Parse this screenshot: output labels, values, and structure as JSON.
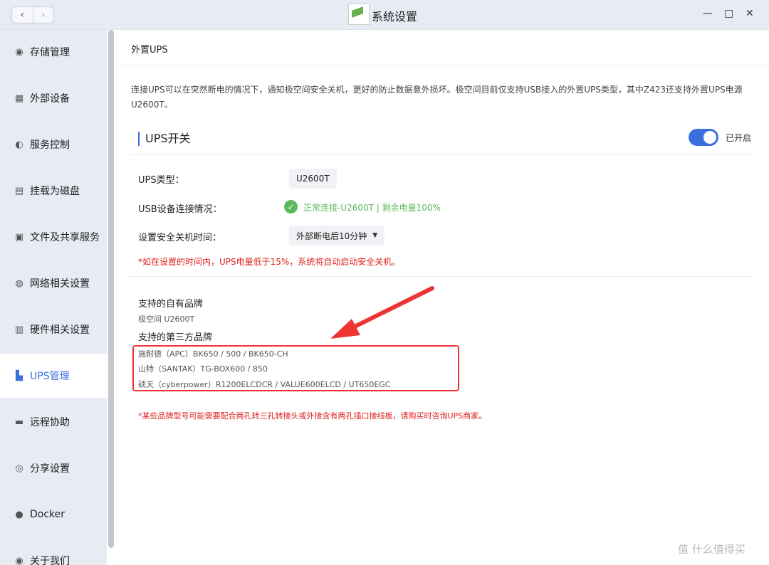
{
  "window": {
    "title": "系统设置",
    "back_icon": "‹",
    "forward_icon": "›",
    "min_icon": "—",
    "max_icon": "□",
    "close_icon": "✕"
  },
  "sidebar": {
    "items": [
      {
        "label": "存储管理",
        "icon": "◉",
        "icon_name": "storage-icon"
      },
      {
        "label": "外部设备",
        "icon": "▦",
        "icon_name": "external-device-icon"
      },
      {
        "label": "服务控制",
        "icon": "◐",
        "icon_name": "service-icon"
      },
      {
        "label": "挂载为磁盘",
        "icon": "▤",
        "icon_name": "mount-disk-icon"
      },
      {
        "label": "文件及共享服务",
        "icon": "▣",
        "icon_name": "file-share-icon"
      },
      {
        "label": "网络相关设置",
        "icon": "◍",
        "icon_name": "network-icon"
      },
      {
        "label": "硬件相关设置",
        "icon": "▥",
        "icon_name": "hardware-icon"
      },
      {
        "label": "UPS管理",
        "icon": "▙",
        "icon_name": "ups-icon"
      },
      {
        "label": "远程协助",
        "icon": "▬",
        "icon_name": "remote-assist-icon"
      },
      {
        "label": "分享设置",
        "icon": "◎",
        "icon_name": "share-icon"
      },
      {
        "label": "Docker",
        "icon": "●",
        "icon_name": "docker-icon"
      },
      {
        "label": "关于我们",
        "icon": "◉",
        "icon_name": "about-icon"
      }
    ],
    "active_index": 7
  },
  "main": {
    "page_title": "外置UPS",
    "intro": "连接UPS可以在突然断电的情况下，通知极空间安全关机，更好的防止数据意外损坏。极空间目前仅支持USB接入的外置UPS类型，其中Z423还支持外置UPS电源U2600T。",
    "section_title": "UPS开关",
    "toggle_label": "已开启",
    "ups_type_label": "UPS类型：",
    "ups_type_value": "U2600T",
    "usb_status_label": "USB设备连接情况：",
    "usb_status_value": "正常连接-U2600T | 剩余电量100%",
    "shutdown_label": "设置安全关机时间：",
    "shutdown_value": "外部断电后10分钟",
    "warning1": "*如在设置的时间内，UPS电量低于15%，系统将自动启动安全关机。",
    "own_brand_title": "支持的自有品牌",
    "own_brand_value": "极空间 U2600T",
    "third_brand_title": "支持的第三方品牌",
    "third_brands": [
      "施耐德（APC）BK650 / 500 / BK650-CH",
      "山特（SANTAK）TG-BOX600 / 850",
      "硕天（cyberpower）R1200ELCDCR / VALUE600ELCD / UT650EGC"
    ],
    "warning2": "*某些品牌型号可能需要配合两孔转三孔转接头或外接含有两孔插口接线板，请购买时咨询UPS商家。"
  },
  "watermark": "值 什么值得买",
  "colors": {
    "accent": "#3b6fe0",
    "success": "#5cb85c",
    "warning": "#e02020",
    "highlight": "#ee3333"
  }
}
